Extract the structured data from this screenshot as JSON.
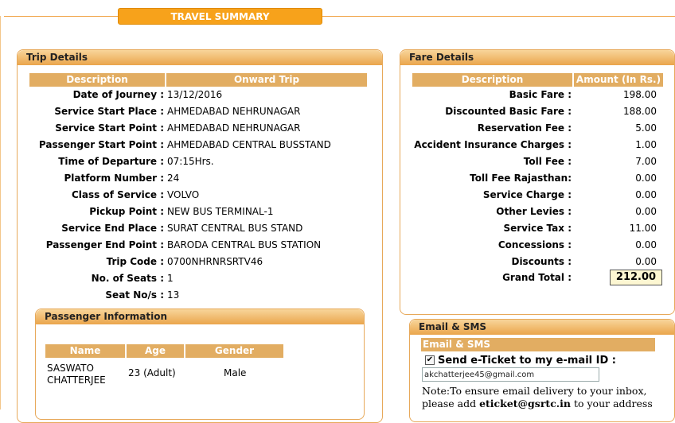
{
  "header": {
    "title": "TRAVEL SUMMARY"
  },
  "trip": {
    "title": "Trip Details",
    "col_description": "Description",
    "col_onward": "Onward Trip",
    "rows": [
      {
        "label": "Date of Journey :",
        "value": "13/12/2016"
      },
      {
        "label": "Service Start Place :",
        "value": "AHMEDABAD NEHRUNAGAR"
      },
      {
        "label": "Service Start Point :",
        "value": "AHMEDABAD NEHRUNAGAR"
      },
      {
        "label": "Passenger Start Point :",
        "value": "AHMEDABAD CENTRAL BUSSTAND"
      },
      {
        "label": "Time of Departure :",
        "value": "07:15Hrs."
      },
      {
        "label": "Platform Number :",
        "value": "24"
      },
      {
        "label": "Class of Service :",
        "value": "VOLVO"
      },
      {
        "label": "Pickup Point :",
        "value": "NEW BUS TERMINAL-1"
      },
      {
        "label": "Service End Place :",
        "value": "SURAT CENTRAL BUS STAND"
      },
      {
        "label": "Passenger End Point :",
        "value": "BARODA CENTRAL BUS STATION"
      },
      {
        "label": "Trip Code :",
        "value": "0700NHRNRSRTV46"
      },
      {
        "label": "No. of Seats :",
        "value": "1"
      },
      {
        "label": "Seat No/s :",
        "value": "13"
      }
    ]
  },
  "passenger": {
    "title": "Passenger Information",
    "col_name": "Name",
    "col_age": "Age",
    "col_gender": "Gender",
    "name_line1": "SASWATO",
    "name_line2": "CHATTERJEE",
    "age": "23  (Adult)",
    "gender": "Male"
  },
  "fare": {
    "title": "Fare Details",
    "col_description": "Description",
    "col_amount": "Amount (In Rs.)",
    "rows": [
      {
        "label": "Basic Fare :",
        "value": "198.00"
      },
      {
        "label": "Discounted Basic Fare :",
        "value": "188.00"
      },
      {
        "label": "Reservation Fee :",
        "value": "5.00"
      },
      {
        "label": "Accident Insurance Charges :",
        "value": "1.00"
      },
      {
        "label": "Toll Fee :",
        "value": "7.00"
      },
      {
        "label": "Toll Fee Rajasthan:",
        "value": "0.00"
      },
      {
        "label": "Service Charge :",
        "value": "0.00"
      },
      {
        "label": "Other Levies :",
        "value": "0.00"
      },
      {
        "label": "Service Tax :",
        "value": "11.00"
      },
      {
        "label": "Concessions :",
        "value": "0.00"
      },
      {
        "label": "Discounts :",
        "value": "0.00"
      }
    ],
    "grand_total_label": "Grand Total :",
    "grand_total_value": "212.00"
  },
  "email_sms": {
    "title": "Email & SMS",
    "subheader": "Email & SMS",
    "send_label": "Send e-Ticket to my e-mail ID :",
    "checked": true,
    "email_value": "akchatterjee45@gmail.com",
    "note_line1": "Note:To ensure email delivery to your inbox,",
    "note_line2_a": "please add ",
    "note_line2_b": "eticket@gsrtc.in",
    "note_line2_c": " to your address"
  },
  "colors": {
    "accent": "#f7a21b",
    "panel_border": "#e7a95a",
    "table_header": "#e2ad62",
    "total_box": "#fdf7d2"
  }
}
